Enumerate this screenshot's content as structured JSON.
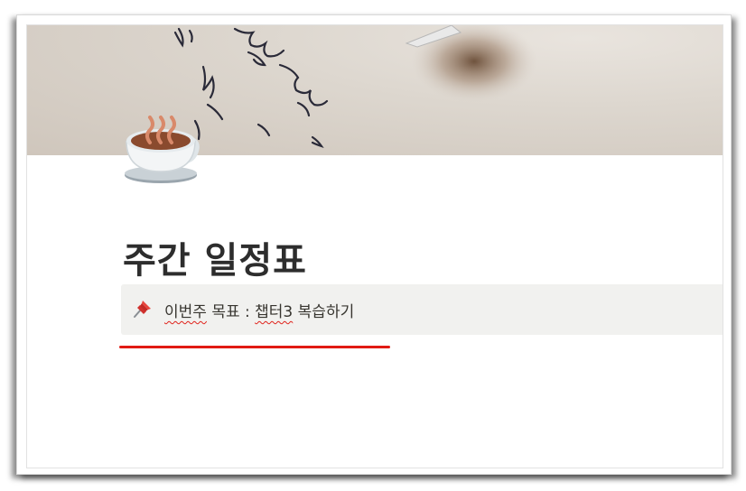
{
  "page": {
    "title": "주간 일정표",
    "icon": "hot-beverage-icon",
    "cover": "handwritten-paper-and-pen-photo"
  },
  "callout": {
    "icon": "pushpin-icon",
    "parts": {
      "word1": "이번주",
      "mid1": " 목표 : ",
      "word2": "챕터3",
      "mid2": " 복습하기"
    }
  },
  "annotation": {
    "underline_color": "#e11b14"
  },
  "colors": {
    "callout_bg": "#f1f1ef",
    "text": "#37352f",
    "title": "#2d2d2d"
  }
}
